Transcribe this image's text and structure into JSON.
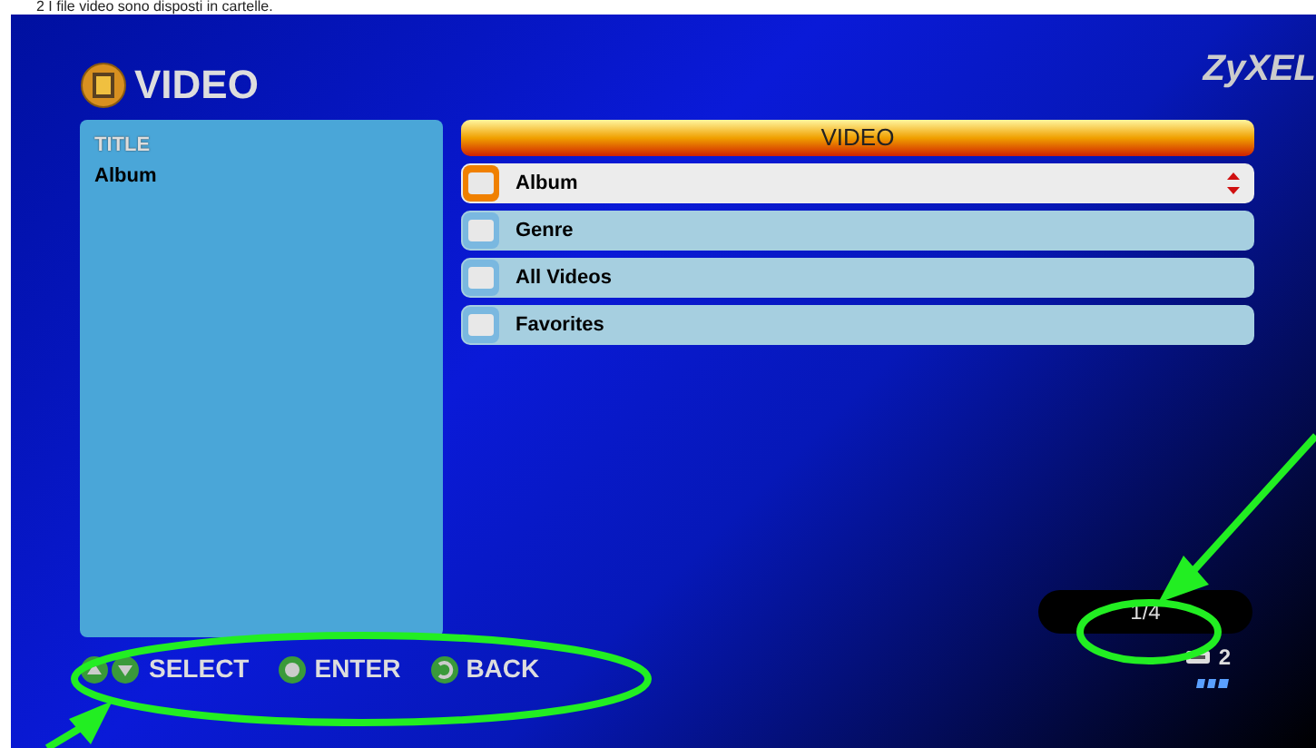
{
  "caption": "2 I file video sono disposti in cartelle.",
  "screen": {
    "title": "VIDEO",
    "brand": "ZyXEL",
    "info_panel": {
      "heading": "TITLE",
      "value": "Album"
    },
    "menu": {
      "header": "VIDEO",
      "items": [
        {
          "label": "Album",
          "selected": true
        },
        {
          "label": "Genre",
          "selected": false
        },
        {
          "label": "All Videos",
          "selected": false
        },
        {
          "label": "Favorites",
          "selected": false
        }
      ]
    },
    "hints": [
      {
        "kind": "updown",
        "label": "SELECT"
      },
      {
        "kind": "enter",
        "label": "ENTER"
      },
      {
        "kind": "back",
        "label": "BACK"
      }
    ],
    "page_indicator": "1/4",
    "device_count": "2"
  }
}
